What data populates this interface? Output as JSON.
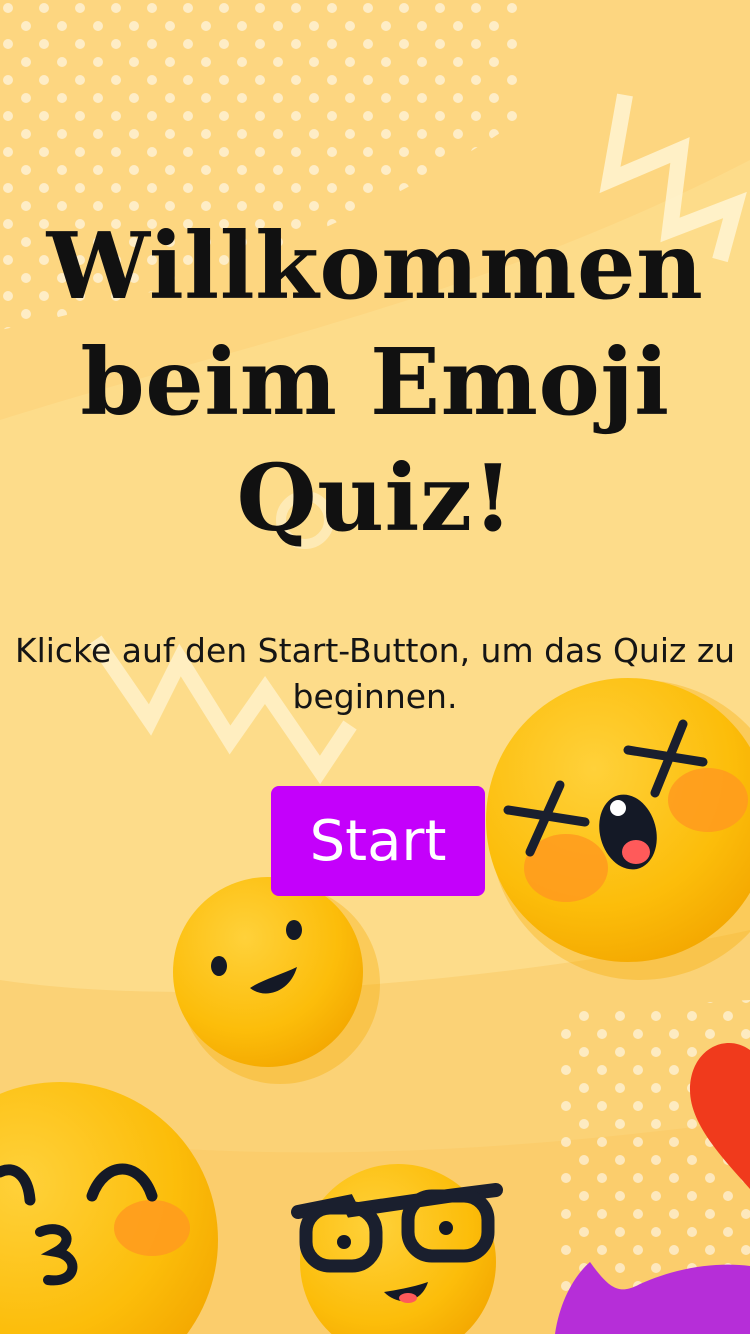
{
  "welcome": {
    "title": "Willkommen beim Emoji Quiz!",
    "subtitle": "Klicke auf den Start-Button, um das Quiz zu beginnen.",
    "start_label": "Start"
  },
  "colors": {
    "background": "#fddc8a",
    "accent_button": "#c400fb",
    "emoji_yellow": "#fcc00e",
    "blush": "#ff9a1f",
    "heart": "#f03a1c",
    "speech_bubble": "#b62ed8"
  },
  "decorations": [
    "dizzy-emoji-icon",
    "smile-emoji-icon",
    "kiss-emoji-icon",
    "nerd-emoji-icon",
    "heart-icon",
    "speech-bubble-icon"
  ]
}
